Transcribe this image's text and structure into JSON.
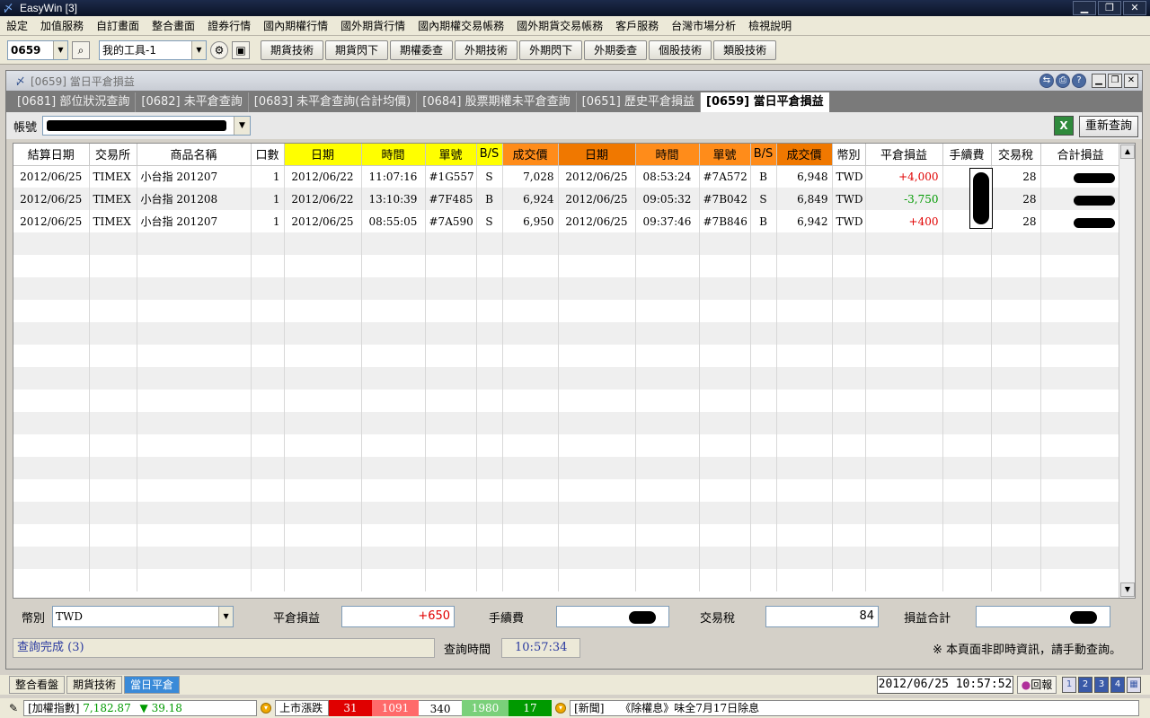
{
  "app": {
    "title": "EasyWin  [3]"
  },
  "menu": [
    "設定",
    "加值服務",
    "自訂畫面",
    "整合畫面",
    "證券行情",
    "國內期權行情",
    "國外期貨行情",
    "國內期權交易帳務",
    "國外期貨交易帳務",
    "客戶服務",
    "台灣市場分析",
    "檢視說明"
  ],
  "toolbar": {
    "code_value": "0659",
    "tool_value": "我的工具-1",
    "buttons": [
      "期貨技術",
      "期貨閃下",
      "期權委查",
      "外期技術",
      "外期閃下",
      "外期委查",
      "個股技術",
      "類股技術"
    ]
  },
  "window": {
    "caption": "[0659] 當日平倉損益",
    "tabs": [
      {
        "label": "[0681] 部位狀況查詢",
        "active": false
      },
      {
        "label": "[0682] 未平倉查詢",
        "active": false
      },
      {
        "label": "[0683] 未平倉查詢(合計均價)",
        "active": false
      },
      {
        "label": "[0684] 股票期權未平倉查詢",
        "active": false
      },
      {
        "label": "[0651] 歷史平倉損益",
        "active": false
      },
      {
        "label": "[0659] 當日平倉損益",
        "active": true
      }
    ],
    "account_label": "帳號",
    "excel_label": "X",
    "requery_label": "重新查詢"
  },
  "grid": {
    "headers": [
      "結算日期",
      "交易所",
      "商品名稱",
      "口數",
      "日期",
      "時間",
      "單號",
      "B/S",
      "成交價",
      "日期",
      "時間",
      "單號",
      "B/S",
      "成交價",
      "幣別",
      "平倉損益",
      "手續費",
      "交易稅",
      "合計損益"
    ],
    "rows": [
      [
        "2012/06/25",
        "TIMEX",
        "小台指 201207",
        "1",
        "2012/06/22",
        "11:07:16",
        "#1G557",
        "S",
        "7,028",
        "2012/06/25",
        "08:53:24",
        "#7A572",
        "B",
        "6,948",
        "TWD",
        "+4,000",
        "",
        "28",
        ""
      ],
      [
        "2012/06/25",
        "TIMEX",
        "小台指 201208",
        "1",
        "2012/06/22",
        "13:10:39",
        "#7F485",
        "B",
        "6,924",
        "2012/06/25",
        "09:05:32",
        "#7B042",
        "S",
        "6,849",
        "TWD",
        "-3,750",
        "",
        "28",
        ""
      ],
      [
        "2012/06/25",
        "TIMEX",
        "小台指 201207",
        "1",
        "2012/06/25",
        "08:55:05",
        "#7A590",
        "S",
        "6,950",
        "2012/06/25",
        "09:37:46",
        "#7B846",
        "B",
        "6,942",
        "TWD",
        "+400",
        "",
        "28",
        ""
      ]
    ],
    "empty_rows": 16
  },
  "summary": {
    "currency_label": "幣別",
    "currency_value": "TWD",
    "pl_label": "平倉損益",
    "pl_value": "+650",
    "fee_label": "手續費",
    "tax_label": "交易稅",
    "tax_value": "84",
    "total_label": "損益合計"
  },
  "status": {
    "text": "查詢完成 (3)",
    "query_time_label": "查詢時間",
    "query_time": "10:57:34",
    "note": "※ 本頁面非即時資訊，請手動查詢。"
  },
  "bottom_tabs": [
    {
      "label": "整合看盤",
      "active": false
    },
    {
      "label": "期貨技術",
      "active": false
    },
    {
      "label": "當日平倉",
      "active": true
    }
  ],
  "clock": "2012/06/25 10:57:52",
  "news_button": "回報",
  "layout_buttons": [
    "1",
    "2",
    "3",
    "4"
  ],
  "ticker": {
    "index_label": "[加權指數]",
    "index_value": "7,182.87",
    "index_change": "▼ 39.18",
    "breadth_label": "上市漲跌",
    "breadth": [
      "31",
      "1091",
      "340",
      "1980",
      "17"
    ],
    "news_label": "[新聞]",
    "news_text": "《除權息》味全7月17日除息"
  },
  "colors": {
    "positive": "#e00000",
    "negative": "#009a00",
    "header_yellow": "#ffff00",
    "header_orange": "#ff8c1a"
  }
}
